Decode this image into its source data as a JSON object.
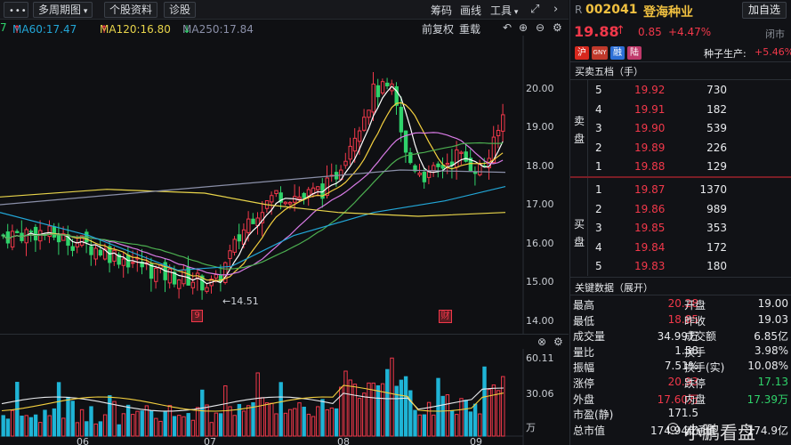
{
  "toolbar": {
    "menu_icon": "menu-dots-icon",
    "period": "多周期图",
    "stock_info": "个股资料",
    "diagnose": "诊股",
    "chips": "筹码",
    "drawline": "画线",
    "tools": "工具",
    "expand_icon": "expand-icon",
    "collapse_icon": "chevron-right-icon"
  },
  "ma_bar": {
    "ma60": "MA60:17.47",
    "ma120": "MA120:16.80",
    "ma250": "MA250:17.84",
    "right_adjust": "前复权",
    "overlay": "重载"
  },
  "main_chart": {
    "y_ticks": [
      "20.00",
      "19.00",
      "18.00",
      "17.00",
      "16.00",
      "15.00",
      "14.00"
    ],
    "low_mark": "←14.51",
    "marker_a": "9",
    "marker_b": "财"
  },
  "volume_chart": {
    "y_ticks": [
      "60.11",
      "30.06",
      "万"
    ],
    "x_ticks": [
      "06",
      "07",
      "08",
      "09"
    ]
  },
  "quote": {
    "prefix": "R",
    "code": "002041",
    "name": "登海种业",
    "add_button": "加自选",
    "price": "19.88",
    "change": "0.85",
    "change_pct": "+4.47%",
    "status": "闭市",
    "badges": [
      "沪",
      "GNY",
      "融",
      "陆"
    ],
    "sector_label": "种子生产:",
    "sector_pct": "+5.46%"
  },
  "order_book": {
    "title": "买卖五档（手）",
    "sell_label": [
      "卖",
      "盘"
    ],
    "buy_label": [
      "买",
      "盘"
    ],
    "asks": [
      {
        "level": "5",
        "price": "19.92",
        "vol": "730"
      },
      {
        "level": "4",
        "price": "19.91",
        "vol": "182"
      },
      {
        "level": "3",
        "price": "19.90",
        "vol": "539"
      },
      {
        "level": "2",
        "price": "19.89",
        "vol": "226"
      },
      {
        "level": "1",
        "price": "19.88",
        "vol": "129"
      }
    ],
    "bids": [
      {
        "level": "1",
        "price": "19.87",
        "vol": "1370"
      },
      {
        "level": "2",
        "price": "19.86",
        "vol": "989"
      },
      {
        "level": "3",
        "price": "19.85",
        "vol": "353"
      },
      {
        "level": "4",
        "price": "19.84",
        "vol": "172"
      },
      {
        "level": "5",
        "price": "19.83",
        "vol": "180"
      }
    ]
  },
  "key_data": {
    "title": "关键数据（展开）",
    "rows": [
      {
        "l1": "最高",
        "v1": "20.28",
        "c1": "red",
        "l2": "开盘",
        "v2": "19.00",
        "c2": "white"
      },
      {
        "l1": "最低",
        "v1": "18.85",
        "c1": "red",
        "l2": "昨收",
        "v2": "19.03",
        "c2": "white"
      },
      {
        "l1": "成交量",
        "v1": "34.99万",
        "c1": "white",
        "l2": "成交额",
        "v2": "6.85亿",
        "c2": "white"
      },
      {
        "l1": "量比",
        "v1": "1.58",
        "c1": "white",
        "l2": "换手",
        "v2": "3.98%",
        "c2": "white"
      },
      {
        "l1": "振幅",
        "v1": "7.51%",
        "c1": "white",
        "l2": "换手(实)",
        "v2": "10.08%",
        "c2": "white"
      },
      {
        "l1": "涨停",
        "v1": "20.93",
        "c1": "red",
        "l2": "跌停",
        "v2": "17.13",
        "c2": "green"
      },
      {
        "l1": "外盘",
        "v1": "17.60万",
        "c1": "red",
        "l2": "内盘",
        "v2": "17.39万",
        "c2": "green"
      },
      {
        "l1": "市盈(静)",
        "v1": "171.5",
        "c1": "white",
        "l2": "",
        "v2": "",
        "c2": "white"
      },
      {
        "l1": "总市值",
        "v1": "174.94亿",
        "c1": "white",
        "l2": "流通值",
        "v2": "174.9亿",
        "c2": "white"
      }
    ]
  },
  "watermark": "小鹏看盘",
  "colors": {
    "up": "#f2384a",
    "down": "#2fd36a",
    "ma5": "#ffffff",
    "ma10": "#f4d03f",
    "ma20": "#d97be6",
    "ma30": "#4caf50",
    "ma60": "#22a7d8",
    "ma120": "#e8d44a",
    "ma250": "#8a8fa8"
  }
}
